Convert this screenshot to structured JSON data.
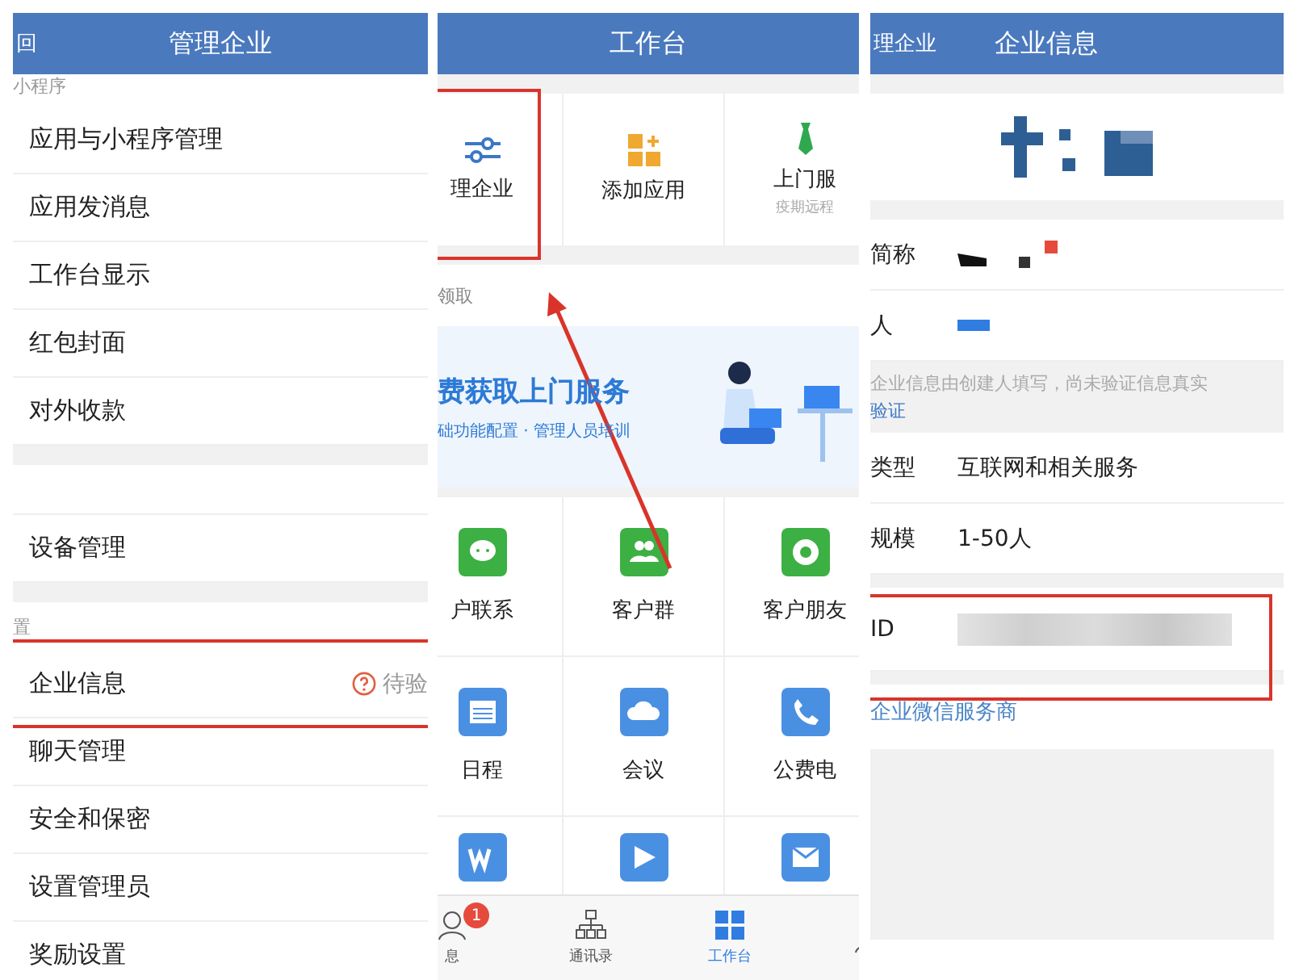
{
  "manage": {
    "back": "回",
    "title": "管理企业",
    "sections": [
      {
        "label": "小程序",
        "items": [
          {
            "label": "应用与小程序管理"
          },
          {
            "label": "应用发消息"
          },
          {
            "label": "工作台显示"
          },
          {
            "label": "红包封面"
          },
          {
            "label": "对外收款"
          }
        ]
      },
      {
        "items": [
          {
            "label": "设备管理"
          }
        ]
      },
      {
        "label": "置",
        "items": [
          {
            "label": "企业信息",
            "status": "待验"
          },
          {
            "label": "聊天管理"
          },
          {
            "label": "安全和保密"
          },
          {
            "label": "设置管理员"
          },
          {
            "label": "奖励设置"
          }
        ]
      }
    ]
  },
  "workbench": {
    "title": "工作台",
    "top_tiles": [
      {
        "label": "理企业"
      },
      {
        "label": "添加应用"
      },
      {
        "label": "上门服",
        "sub": "疫期远程"
      }
    ],
    "section_label": "领取",
    "banner": {
      "title": "费获取上门服务",
      "subtitle": "础功能配置 · 管理人员培训"
    },
    "apps": [
      {
        "kind": "chat",
        "label": "户联系"
      },
      {
        "kind": "group",
        "label": "客户群"
      },
      {
        "kind": "moments",
        "label": "客户朋友"
      },
      {
        "kind": "calendar",
        "label": "日程"
      },
      {
        "kind": "meeting",
        "label": "会议"
      },
      {
        "kind": "phone",
        "label": "公费电"
      },
      {
        "kind": "doc"
      },
      {
        "kind": "video"
      },
      {
        "kind": "mail"
      }
    ],
    "tabs": [
      {
        "label": "息",
        "badge": "1",
        "selected": false
      },
      {
        "label": "通讯录",
        "selected": false
      },
      {
        "label": "工作台",
        "selected": true
      },
      {
        "selected": false
      }
    ]
  },
  "info": {
    "back": "理企业",
    "title": "企业信息",
    "rows_top": [
      {
        "label": "简称",
        "kind": "redacted"
      },
      {
        "label": "人",
        "kind": "redacted-blue"
      }
    ],
    "notice": "企业信息由创建人填写，尚未验证信息真实",
    "notice_link": "验证",
    "rows": [
      {
        "label": "类型",
        "value": "互联网和相关服务"
      },
      {
        "label": "规模",
        "value": "1-50人"
      },
      {
        "label": "ID",
        "kind": "blurred"
      }
    ],
    "link": "企业微信服务商"
  }
}
